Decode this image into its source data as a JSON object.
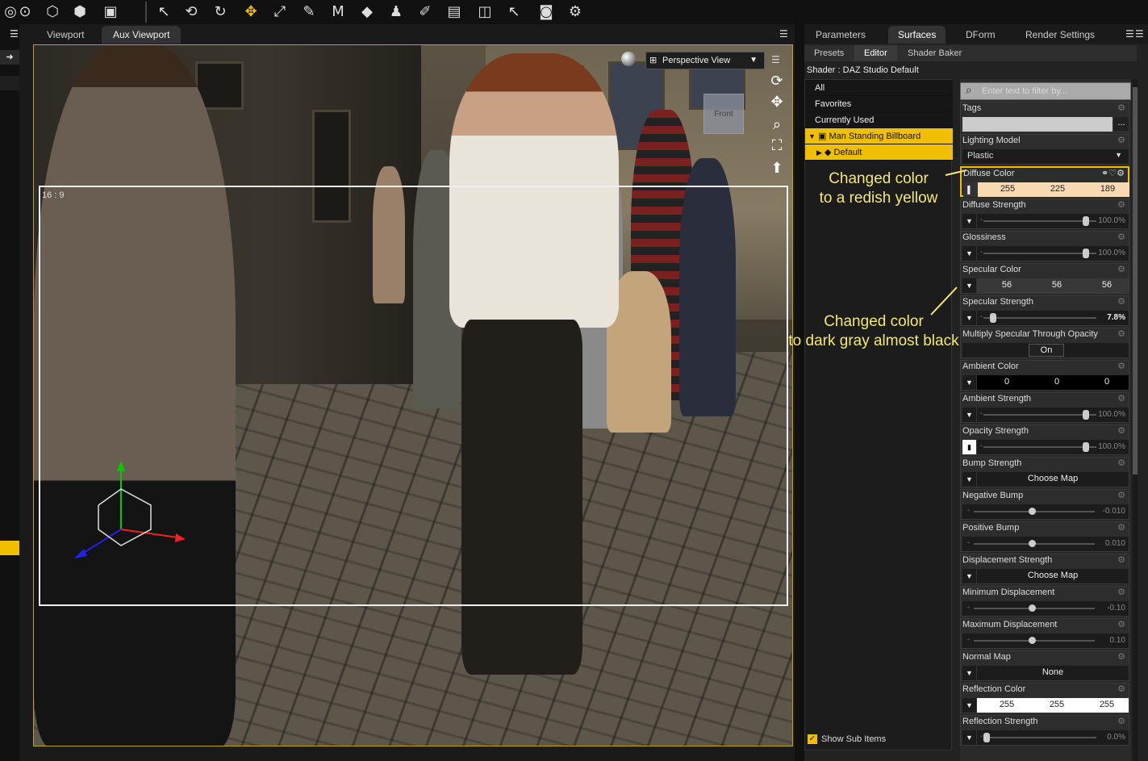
{
  "toolbar": {
    "icons": [
      "node-icon",
      "primitive-icon",
      "group-icon",
      "figure-icon",
      "pointer-icon",
      "rotate-tool-icon",
      "orbit-icon",
      "universal-tool-icon",
      "scale-tool-icon",
      "joint-editor-icon",
      "morph-icon",
      "geometry-editor-icon",
      "figure-setup-icon",
      "surface-selection-icon",
      "edit-tool-icon",
      "render-icon",
      "pointer-settings-icon",
      "camera-icon",
      "render-settings-icon"
    ]
  },
  "viewport": {
    "tabs": [
      "Viewport",
      "Aux Viewport"
    ],
    "active_tab": "Aux Viewport",
    "camera": "Perspective View",
    "aspect_label": "16 : 9",
    "navcube_label": "Front"
  },
  "panel": {
    "tabs": [
      "Parameters",
      "Surfaces",
      "DForm",
      "Render Settings"
    ],
    "active_tab": "Surfaces",
    "subtabs": [
      "Presets",
      "Editor",
      "Shader Baker"
    ],
    "active_subtab": "Editor",
    "shader_label": "Shader : DAZ Studio Default",
    "tree": [
      "All",
      "Favorites",
      "Currently Used",
      "Man Standing Billboard",
      "Default"
    ],
    "selected_tree": "Man Standing Billboard",
    "show_sub_items": "Show Sub Items",
    "filter_placeholder": "Enter text to filter by...",
    "props": {
      "tags": "Tags",
      "tags_btn": "...",
      "lighting_model": "Lighting Model",
      "lighting_value": "Plastic",
      "diffuse_color": "Diffuse Color",
      "diffuse_rgb": [
        "255",
        "225",
        "189"
      ],
      "diffuse_strength": "Diffuse Strength",
      "diffuse_strength_val": "100.0%",
      "glossiness": "Glossiness",
      "glossiness_val": "100.0%",
      "specular_color": "Specular Color",
      "specular_rgb": [
        "56",
        "56",
        "56"
      ],
      "specular_strength": "Specular Strength",
      "specular_strength_val": "7.8%",
      "multiply_specular": "Multiply Specular Through Opacity",
      "multiply_specular_val": "On",
      "ambient_color": "Ambient Color",
      "ambient_rgb": [
        "0",
        "0",
        "0"
      ],
      "ambient_strength": "Ambient Strength",
      "ambient_strength_val": "100.0%",
      "opacity_strength": "Opacity Strength",
      "opacity_strength_val": "100.0%",
      "bump_strength": "Bump Strength",
      "choose_map": "Choose Map",
      "negative_bump": "Negative Bump",
      "negative_bump_val": "-0.010",
      "positive_bump": "Positive Bump",
      "positive_bump_val": "0.010",
      "displacement_strength": "Displacement Strength",
      "min_displacement": "Minimum Displacement",
      "min_displacement_val": "-0.10",
      "max_displacement": "Maximum Displacement",
      "max_displacement_val": "0.10",
      "normal_map": "Normal Map",
      "normal_map_val": "None",
      "reflection_color": "Reflection Color",
      "reflection_rgb": [
        "255",
        "255",
        "255"
      ],
      "reflection_strength": "Reflection Strength",
      "reflection_strength_val": "0.0%"
    }
  },
  "annotations": {
    "a1_line1": "Changed color",
    "a1_line2": "to a redish yellow",
    "a2_line1": "Changed color",
    "a2_line2": "to dark gray almost black"
  },
  "colors": {
    "accent": "#f0c000",
    "diffuse": "#ffe1bd",
    "specular": "#383838",
    "annotation": "#f5e870"
  }
}
